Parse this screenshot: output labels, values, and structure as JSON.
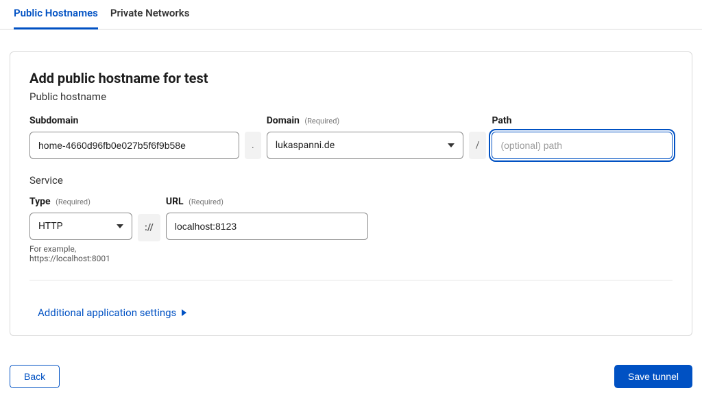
{
  "tabs": {
    "public": "Public Hostnames",
    "private": "Private Networks"
  },
  "heading": "Add public hostname for test",
  "sub_heading": "Public hostname",
  "subdomain": {
    "label": "Subdomain",
    "value": "home-4660d96fb0e027b5f6f9b58e"
  },
  "separator_dot": ".",
  "domain": {
    "label": "Domain",
    "required": "(Required)",
    "value": "lukaspanni.de"
  },
  "separator_slash": "/",
  "path": {
    "label": "Path",
    "placeholder": "(optional) path",
    "value": ""
  },
  "service_heading": "Service",
  "type": {
    "label": "Type",
    "required": "(Required)",
    "value": "HTTP"
  },
  "separator_proto": "://",
  "url": {
    "label": "URL",
    "required": "(Required)",
    "value": "localhost:8123"
  },
  "hint": "For example, https://localhost:8001",
  "additional_settings": "Additional application settings",
  "back_label": "Back",
  "save_label": "Save tunnel"
}
